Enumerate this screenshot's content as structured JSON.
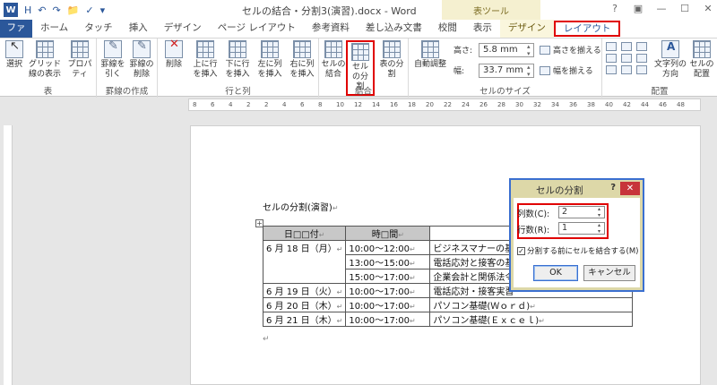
{
  "app": {
    "title": "セルの結合・分割3(演習).docx - Word",
    "tools_title": "表ツール",
    "logo": "W"
  },
  "qat": [
    "H",
    "↶",
    "↷",
    "📁",
    "✓",
    "▾"
  ],
  "window_controls": [
    "?",
    "▣",
    "—",
    "☐",
    "✕"
  ],
  "tabs": [
    {
      "label": "ファイル"
    },
    {
      "label": "ホーム"
    },
    {
      "label": "タッチ"
    },
    {
      "label": "挿入"
    },
    {
      "label": "デザイン"
    },
    {
      "label": "ページ レイアウト"
    },
    {
      "label": "参考資料"
    },
    {
      "label": "差し込み文書"
    },
    {
      "label": "校閲"
    },
    {
      "label": "表示"
    },
    {
      "label": "デザイン"
    },
    {
      "label": "レイアウト"
    }
  ],
  "ribbon": {
    "groups": {
      "table": "表",
      "draw": "罫線の作成",
      "rowcol": "行と列",
      "merge": "結合",
      "cellsize": "セルのサイズ",
      "align": "配置"
    },
    "buttons": {
      "select": "選択",
      "gridlines": "グリッド線の表示",
      "properties": "プロパティ",
      "draw_border": "罫線を引く",
      "erase_border": "罫線の削除",
      "delete": "削除",
      "insert_above": "上に行を挿入",
      "insert_below": "下に行を挿入",
      "insert_left": "左に列を挿入",
      "insert_right": "右に列を挿入",
      "merge_cells": "セルの結合",
      "split_cells": "セルの分割",
      "split_table": "表の分割",
      "autofit": "自動調整",
      "distribute_rows": "高さを揃える",
      "distribute_cols": "幅を揃える",
      "text_direction": "文字列の方向",
      "cell_margins": "セルの配置"
    },
    "height_label": "高さ:",
    "height_value": "5.8 mm",
    "width_label": "幅:",
    "width_value": "33.7 mm"
  },
  "ruler_marks": [
    "8",
    "6",
    "4",
    "2",
    "2",
    "4",
    "6",
    "8",
    "10",
    "12",
    "14",
    "16",
    "18",
    "20",
    "22",
    "24",
    "26",
    "28",
    "30",
    "32",
    "34",
    "36",
    "38",
    "40",
    "42",
    "44",
    "46",
    "48"
  ],
  "document": {
    "heading": "セルの分割(演習)",
    "para_mark": "↵",
    "table_handle": "+",
    "headers": [
      "日□□付",
      "時□間",
      ""
    ],
    "rows": [
      [
        "6 月 18 日（月）",
        "10:00～12:00",
        "ビジネスマナーの基"
      ],
      [
        "",
        "13:00～15:00",
        "電話応対と接客の基"
      ],
      [
        "",
        "15:00～17:00",
        "企業会計と関係法令"
      ],
      [
        "6 月 19 日（火）",
        "10:00～17:00",
        "電話応対・接客実習"
      ],
      [
        "6 月 20 日（木）",
        "10:00～17:00",
        "パソコン基礎(Ｗｏｒｄ)"
      ],
      [
        "6 月 21 日（木）",
        "10:00～17:00",
        "パソコン基礎(Ｅｘｃｅｌ)"
      ]
    ]
  },
  "dialog": {
    "title": "セルの分割",
    "help": "?",
    "close": "✕",
    "cols_label": "列数(C):",
    "cols_value": "2",
    "rows_label": "行数(R):",
    "rows_value": "1",
    "merge_checkbox": "分割する前にセルを結合する(M)",
    "checkbox_mark": "✓",
    "ok": "OK",
    "cancel": "キャンセル"
  }
}
